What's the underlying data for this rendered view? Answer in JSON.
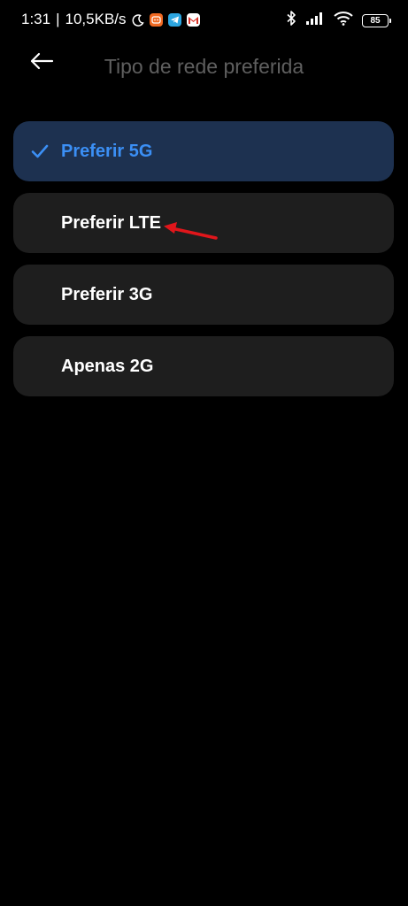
{
  "status_bar": {
    "time": "1:31",
    "separator": "|",
    "network_speed": "10,5KB/s",
    "battery_level": "85",
    "notification_icons": [
      "moon-icon",
      "mi-app-icon",
      "telegram-icon",
      "gmail-icon"
    ],
    "system_icons": [
      "bluetooth-icon",
      "signal-icon",
      "wifi-icon",
      "battery-icon"
    ]
  },
  "header": {
    "title": "Tipo de rede preferida",
    "back_icon": "back-arrow-icon"
  },
  "options": [
    {
      "label": "Preferir 5G",
      "selected": true
    },
    {
      "label": "Preferir LTE",
      "selected": false
    },
    {
      "label": "Preferir 3G",
      "selected": false
    },
    {
      "label": "Apenas 2G",
      "selected": false
    }
  ],
  "colors": {
    "background": "#000000",
    "card": "#1e1e1e",
    "card_selected": "#1d3150",
    "accent": "#3b8ff5",
    "title_gray": "#5f5f5f",
    "annotation_arrow": "#e0161b"
  }
}
